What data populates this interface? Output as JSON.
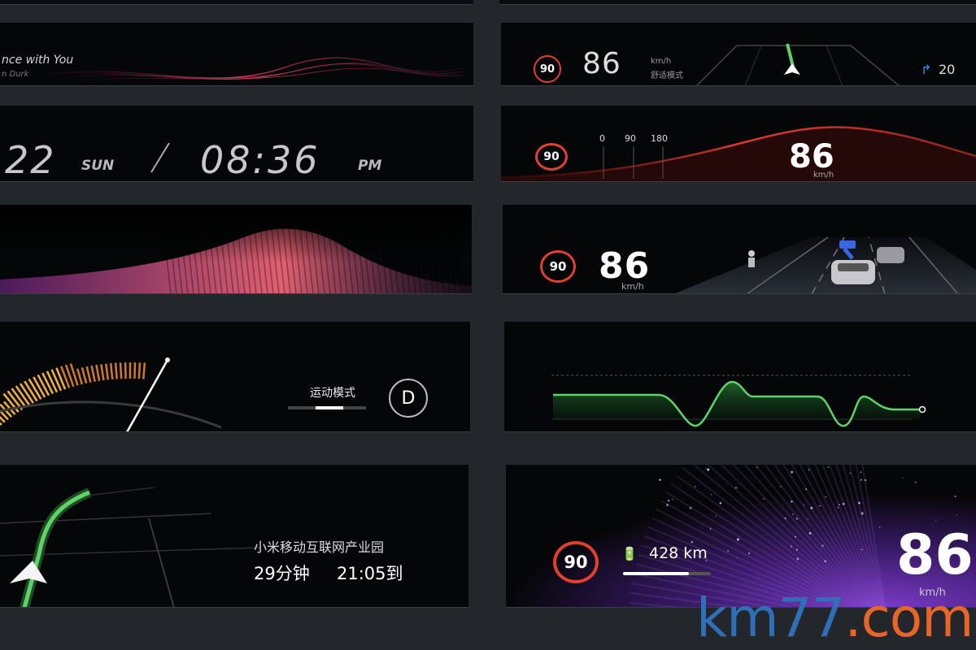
{
  "music": {
    "title": "nce with You",
    "artist": "n Durk"
  },
  "clock": {
    "date": "22",
    "day": "SUN",
    "time": "08:36",
    "ampm": "PM"
  },
  "nav_small": {
    "limit": "90",
    "speed": "86",
    "unit": "km/h",
    "mode": "舒适模式",
    "distance": "20"
  },
  "speed_wave": {
    "limit": "90",
    "speed": "86",
    "unit": "km/h",
    "ticks": [
      "0",
      "90",
      "180"
    ]
  },
  "adas": {
    "limit": "90",
    "speed": "86",
    "unit": "km/h"
  },
  "sport": {
    "mode": "运动模式",
    "gear": "D"
  },
  "navigation": {
    "destination": "小米移动互联网产业园",
    "eta_minutes": "29分钟",
    "arrival": "21:05到"
  },
  "range_panel": {
    "limit": "90",
    "range": "428 km",
    "range_fraction": 0.75,
    "speed": "86",
    "unit": "km/h"
  },
  "watermark": {
    "text_a": "km77",
    "text_b": ".com",
    "color_a": "#2f6fb8",
    "color_b": "#e8652a"
  },
  "colors": {
    "red_accent": "#e2402e",
    "green_accent": "#5fd36a",
    "amber_accent": "#f5b23a"
  }
}
